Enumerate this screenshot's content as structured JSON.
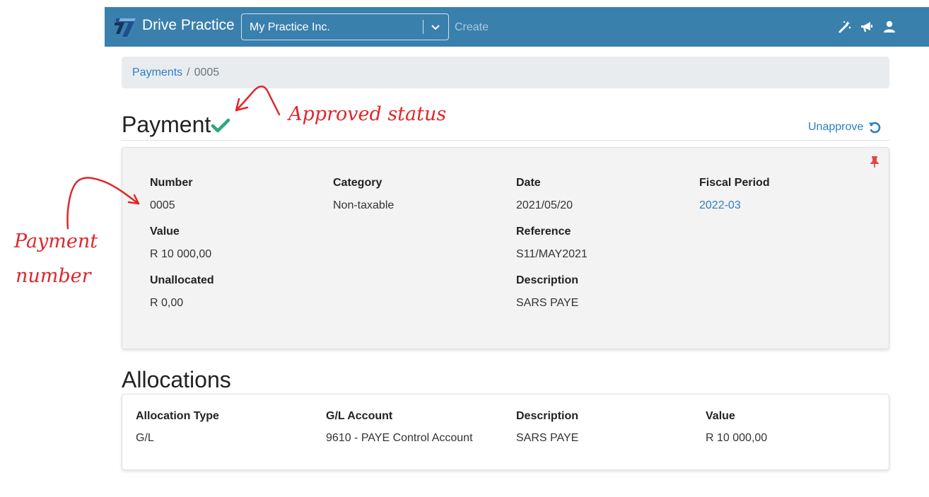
{
  "navbar": {
    "brand": "Drive Practice",
    "company": "My Practice Inc.",
    "create_label": "Create",
    "icons": [
      "magic-wand-icon",
      "megaphone-icon",
      "user-icon"
    ],
    "background": "#3a80ad"
  },
  "breadcrumb": {
    "parent": "Payments",
    "separator": "/",
    "current": "0005"
  },
  "page": {
    "title": "Payment",
    "status_icon": "check-icon",
    "unapprove_label": "Unapprove"
  },
  "details": {
    "number_label": "Number",
    "number_value": "0005",
    "category_label": "Category",
    "category_value": "Non-taxable",
    "date_label": "Date",
    "date_value": "2021/05/20",
    "fiscal_period_label": "Fiscal Period",
    "fiscal_period_value": "2022-03",
    "value_label": "Value",
    "value_value": "R 10 000,00",
    "reference_label": "Reference",
    "reference_value": "S11/MAY2021",
    "unallocated_label": "Unallocated",
    "unallocated_value": "R 0,00",
    "description_label": "Description",
    "description_value": "SARS PAYE"
  },
  "allocations": {
    "title": "Allocations",
    "columns": [
      "Allocation Type",
      "G/L Account",
      "Description",
      "Value"
    ],
    "rows": [
      {
        "type": "G/L",
        "account": "9610 - PAYE Control Account",
        "description": "SARS PAYE",
        "value": "R 10 000,00"
      }
    ]
  },
  "annotations": {
    "status_note": "Approved status",
    "number_note_line1": "Payment",
    "number_note_line2": "number",
    "color": "#e0262b"
  }
}
